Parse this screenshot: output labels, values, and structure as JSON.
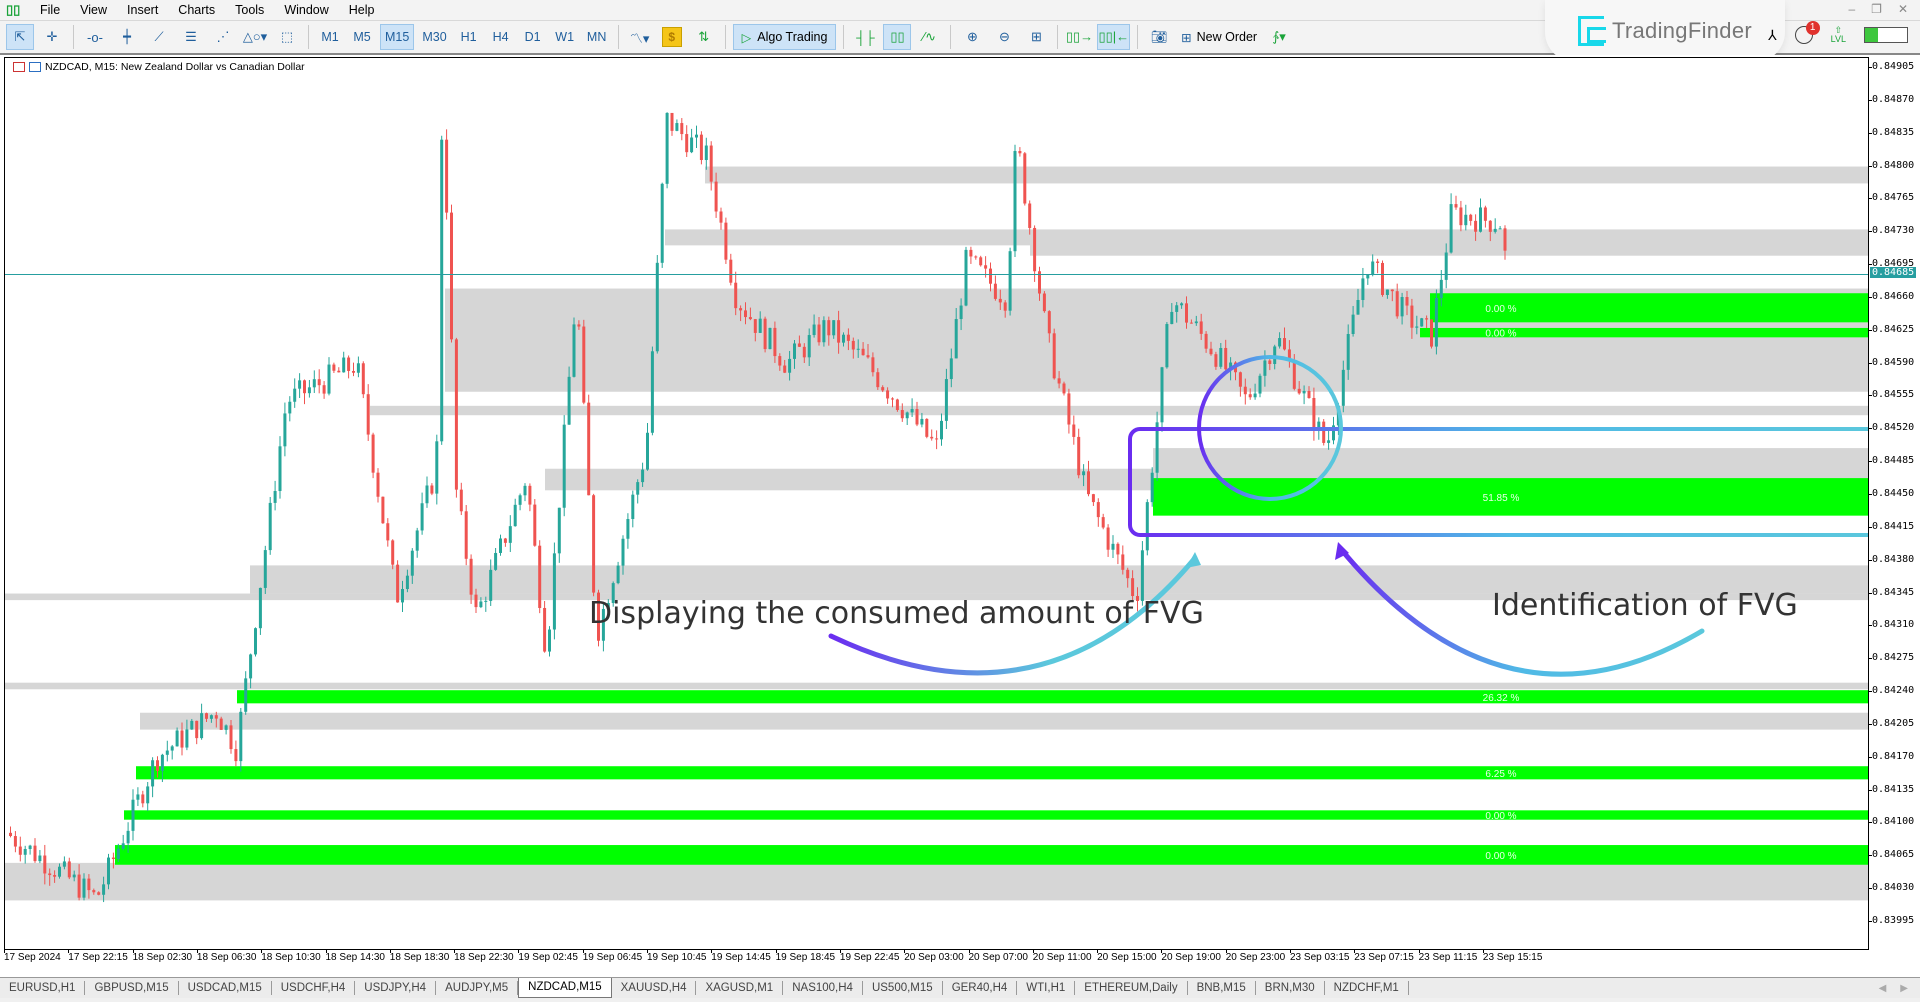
{
  "menu": {
    "items": [
      "File",
      "View",
      "Insert",
      "Charts",
      "Tools",
      "Window",
      "Help"
    ]
  },
  "toolbar": {
    "timeframes": [
      "M1",
      "M5",
      "M15",
      "M30",
      "H1",
      "H4",
      "D1",
      "W1",
      "MN"
    ],
    "active_timeframe": "M15",
    "algo_trading_label": "Algo Trading",
    "new_order_label": "New Order",
    "notification_count": "1",
    "lvl_label": "LVL",
    "lvl_progress": 0.3
  },
  "brand": {
    "name": "TradingFinder"
  },
  "chart": {
    "title": "NZDCAD, M15:  New Zealand Dollar vs Canadian Dollar",
    "current_price": "0.84685",
    "colors": {
      "bull": "#26a69a",
      "bear": "#ef5350",
      "fvg_active": "#00ff00",
      "fvg_filled": "#d6d6d6",
      "price_line": "#269ea0"
    }
  },
  "price_axis": [
    "0.84905",
    "0.84870",
    "0.84835",
    "0.84800",
    "0.84765",
    "0.84730",
    "0.84695",
    "0.84660",
    "0.84625",
    "0.84590",
    "0.84555",
    "0.84520",
    "0.84485",
    "0.84450",
    "0.84415",
    "0.84380",
    "0.84345",
    "0.84310",
    "0.84275",
    "0.84240",
    "0.84205",
    "0.84170",
    "0.84135",
    "0.84100",
    "0.84065",
    "0.84030",
    "0.83995"
  ],
  "time_axis": [
    "17 Sep 2024",
    "17 Sep 22:15",
    "18 Sep 02:30",
    "18 Sep 06:30",
    "18 Sep 10:30",
    "18 Sep 14:30",
    "18 Sep 18:30",
    "18 Sep 22:30",
    "19 Sep 02:45",
    "19 Sep 06:45",
    "19 Sep 10:45",
    "19 Sep 14:45",
    "19 Sep 18:45",
    "19 Sep 22:45",
    "20 Sep 03:00",
    "20 Sep 07:00",
    "20 Sep 11:00",
    "20 Sep 15:00",
    "20 Sep 19:00",
    "20 Sep 23:00",
    "23 Sep 03:15",
    "23 Sep 07:15",
    "23 Sep 11:15",
    "23 Sep 15:15"
  ],
  "fvg_zones": [
    {
      "top": 0.84665,
      "bottom": 0.84634,
      "label": "0.00 %",
      "state": "active"
    },
    {
      "top": 0.84628,
      "bottom": 0.84618,
      "label": "0.00 %",
      "state": "active"
    },
    {
      "top": 0.84468,
      "bottom": 0.84428,
      "label": "51.85 %",
      "state": "active"
    },
    {
      "top": 0.84242,
      "bottom": 0.84228,
      "label": "26.32 %",
      "state": "active"
    },
    {
      "top": 0.84161,
      "bottom": 0.84147,
      "label": "6.25 %",
      "state": "active"
    },
    {
      "top": 0.84114,
      "bottom": 0.84104,
      "label": "0.00 %",
      "state": "active"
    },
    {
      "top": 0.84077,
      "bottom": 0.84056,
      "label": "0.00 %",
      "state": "active"
    }
  ],
  "annotations": {
    "consumed": "Displaying the consumed amount of FVG",
    "identification": "Identification of FVG"
  },
  "tabs": [
    "EURUSD,H1",
    "GBPUSD,M15",
    "USDCAD,M15",
    "USDCHF,H4",
    "USDJPY,H4",
    "AUDJPY,M5",
    "NZDCAD,M15",
    "XAUUSD,H4",
    "XAGUSD,M1",
    "NAS100,H4",
    "US500,M15",
    "GER40,H4",
    "WTI,H1",
    "ETHEREUM,Daily",
    "BNB,M15",
    "BRN,M30",
    "NZDCHF,M1"
  ],
  "active_tab": "NZDCAD,M15"
}
